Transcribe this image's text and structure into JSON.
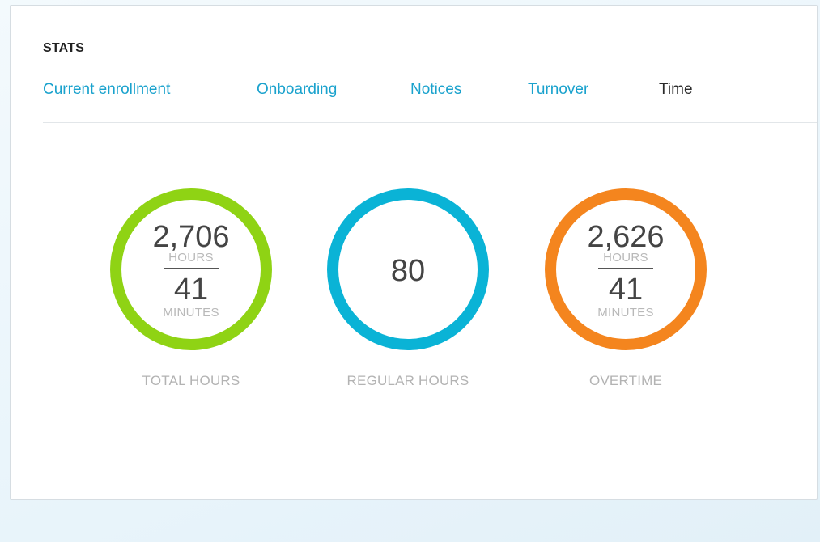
{
  "section": {
    "title": "STATS"
  },
  "tabs": [
    {
      "label": "Current enrollment",
      "active": false
    },
    {
      "label": "Onboarding",
      "active": false
    },
    {
      "label": "Notices",
      "active": false
    },
    {
      "label": "Turnover",
      "active": false
    },
    {
      "label": "Time",
      "active": true
    }
  ],
  "stats": [
    {
      "hours": "2,706",
      "hours_unit": "HOURS",
      "minutes": "41",
      "minutes_unit": "MINUTES",
      "label": "TOTAL HOURS",
      "color": "#8fd314"
    },
    {
      "value": "80",
      "label": "REGULAR HOURS",
      "color": "#0ab3d6"
    },
    {
      "hours": "2,626",
      "hours_unit": "HOURS",
      "minutes": "41",
      "minutes_unit": "MINUTES",
      "label": "OVERTIME",
      "color": "#f4851e"
    }
  ],
  "colors": {
    "link": "#1aa2cd",
    "active_tab": "#2b2b2b"
  }
}
